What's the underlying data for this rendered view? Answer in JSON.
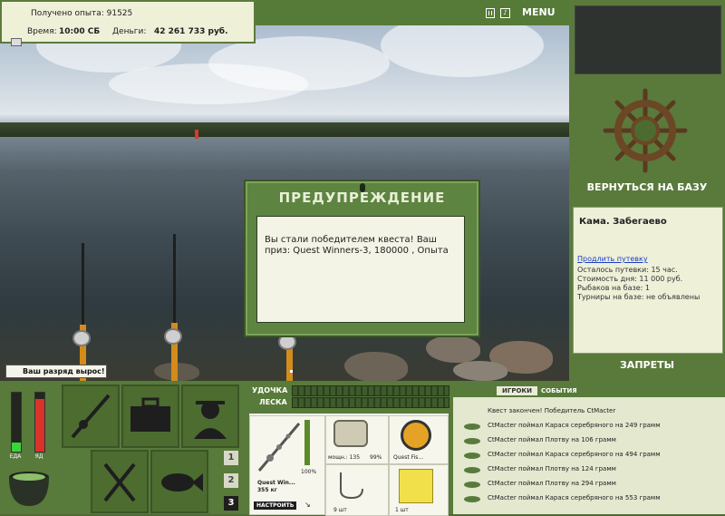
{
  "header": {
    "exp_label": "Получено опыта:",
    "exp_value": "91525",
    "time_label": "Время:",
    "time_value": "10:00 СБ",
    "money_label": "Деньги:",
    "money_value": "42 261 733 руб.",
    "menu_label": "MENU"
  },
  "modal": {
    "title": "ПРЕДУПРЕЖДЕНИЕ",
    "text": "Вы стали победителем квеста! Ваш приз: Quest Winners-3, 180000 , Опыта"
  },
  "notice": {
    "text": "Ваш разряд вырос!"
  },
  "right": {
    "return_label": "ВЕРНУТЬСЯ НА БАЗУ",
    "location": "Кама. Забегаево",
    "extend_link": "Продлить путевку",
    "info": [
      "Осталось путевки: 15 час.",
      "Стоимость дня: 11 000 руб.",
      "Рыбаков на базе: 1",
      "Турниры на базе: не объявлены"
    ],
    "bans_label": "ЗАПРЕТЫ"
  },
  "meters": {
    "food_label": "ЕДА",
    "poison_label": "ЯД"
  },
  "slots": {
    "nums": [
      "1",
      "2",
      "3"
    ]
  },
  "tackle": {
    "rod_label": "УДОЧКА",
    "line_label": "ЛЕСКА",
    "rod_name": "Quest Win...",
    "rod_weight": "355 кг",
    "setup_button": "НАСТРОИТЬ",
    "percent": "100%",
    "reel_text": "мощн.: 135",
    "reel_percent": "99%",
    "line_name": "Quest Fis...",
    "hook_count": "9 шт",
    "bait_count": "1 шт"
  },
  "events": {
    "tab_players": "ИГРОКИ",
    "tab_events": "СОБЫТИЯ",
    "items": [
      "Квест закончен! Победитель CtMacter",
      "CtMacter поймал Карася серебряного на 249 грамм",
      "CtMacter поймал Плотву на 106 грамм",
      "CtMacter поймал Карася серебряного на 494 грамм",
      "CtMacter поймал Плотву на 124 грамм",
      "CtMacter поймал Плотву на 294 грамм",
      "CtMacter поймал Карася серебряного на 553 грамм"
    ]
  },
  "colors": {
    "panel": "#5a7a3c",
    "rod_handle": "#d38b1a",
    "modal_bg": "#5d8440"
  }
}
